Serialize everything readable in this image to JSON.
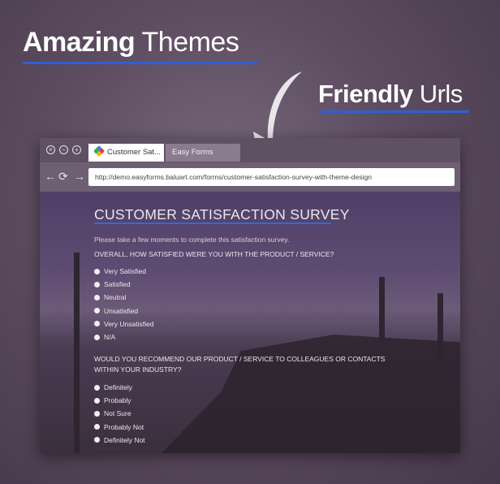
{
  "headline1": {
    "bold": "Amazing",
    "rest": " Themes"
  },
  "headline2": {
    "bold": "Friendly",
    "rest": " Urls"
  },
  "colors": {
    "accent": "#2f5fd6"
  },
  "browser": {
    "controls": [
      "close-icon",
      "minimize-icon",
      "maximize-icon"
    ],
    "tabs": [
      {
        "label": "Customer Sat..."
      },
      {
        "label": "Easy Forms"
      }
    ],
    "url": "http://demo.easyforms.baluart.com/forms/customer-satisfaction-survey-with-theme-design"
  },
  "form": {
    "title": "CUSTOMER SATISFACTION SURVEY",
    "description": "Please take a few moments to complete this satisfaction survey.",
    "q1": {
      "label": "OVERALL, HOW SATISFIED WERE YOU WITH THE PRODUCT / SERVICE?",
      "options": [
        "Very Satisfied",
        "Satisfied",
        "Neutral",
        "Unsatisfied",
        "Very Unsatisfied",
        "N/A"
      ]
    },
    "q2": {
      "label": "WOULD YOU RECOMMEND OUR PRODUCT / SERVICE TO COLLEAGUES OR CONTACTS WITHIN YOUR INDUSTRY?",
      "options": [
        "Definitely",
        "Probably",
        "Not Sure",
        "Probably Not",
        "Definitely Not"
      ]
    }
  }
}
